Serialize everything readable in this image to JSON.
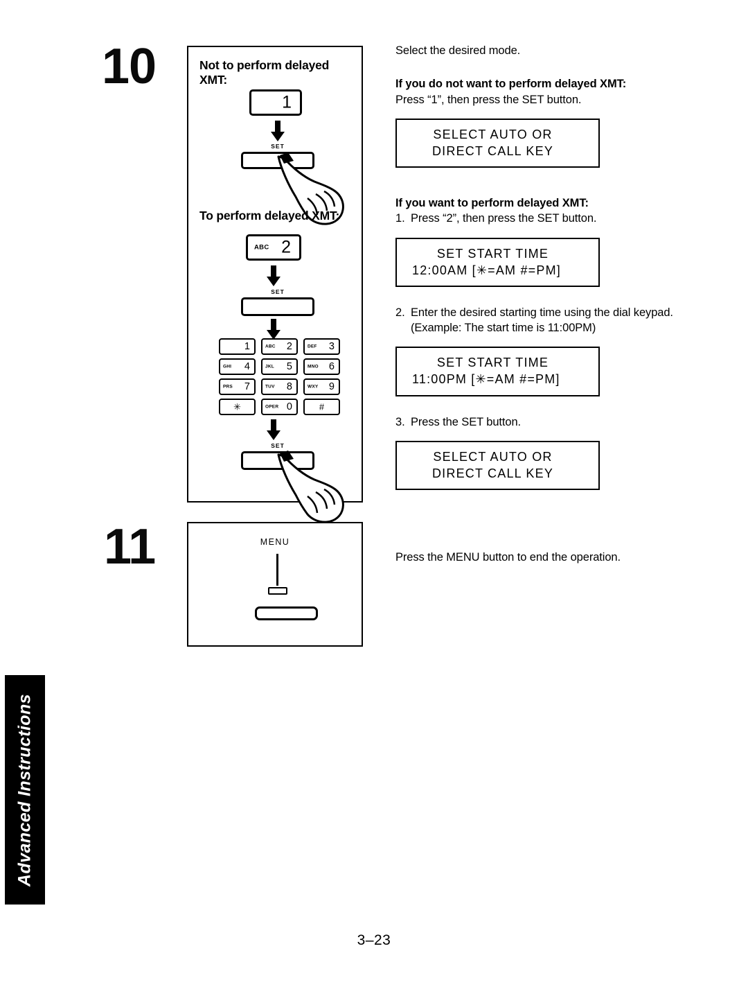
{
  "page": {
    "number": "3–23",
    "side_tab": "Advanced Instructions"
  },
  "steps": [
    {
      "number": "10",
      "illustration": {
        "heading_not_delayed": "Not to perform delayed XMT:",
        "heading_to_delayed": "To perform delayed XMT:",
        "key_one_digit": "1",
        "key_two_letters": "ABC",
        "key_two_digit": "2",
        "set_button_label": "SET",
        "keypad": [
          [
            {
              "letters": "",
              "digit": "1"
            },
            {
              "letters": "ABC",
              "digit": "2"
            },
            {
              "letters": "DEF",
              "digit": "3"
            }
          ],
          [
            {
              "letters": "GHI",
              "digit": "4"
            },
            {
              "letters": "JKL",
              "digit": "5"
            },
            {
              "letters": "MNO",
              "digit": "6"
            }
          ],
          [
            {
              "letters": "PRS",
              "digit": "7"
            },
            {
              "letters": "TUV",
              "digit": "8"
            },
            {
              "letters": "WXY",
              "digit": "9"
            }
          ],
          [
            {
              "letters": "",
              "digit": "",
              "center": "✳"
            },
            {
              "letters": "OPER",
              "digit": "0"
            },
            {
              "letters": "",
              "digit": "",
              "center": "#"
            }
          ]
        ]
      },
      "instructions": {
        "intro": "Select the desired mode.",
        "not_delayed_heading": "If you do not want to perform delayed XMT:",
        "not_delayed_text": "Press “1”, then press the SET button.",
        "lcd_1": {
          "line1": "SELECT AUTO OR",
          "line2": "DIRECT CALL KEY"
        },
        "delayed_heading": "If you want to perform delayed XMT:",
        "item_1_num": "1.",
        "item_1_text": "Press “2”, then press the SET button.",
        "lcd_2": {
          "line1": "SET START TIME",
          "line2": "12:00AM [✳=AM #=PM]"
        },
        "item_2_num": "2.",
        "item_2_text": "Enter the desired starting time using the dial keypad. (Example:  The start time is 11:00PM)",
        "lcd_3": {
          "line1": "SET START TIME",
          "line2": "11:00PM [✳=AM #=PM]"
        },
        "item_3_num": "3.",
        "item_3_text": "Press the SET button.",
        "lcd_4": {
          "line1": "SELECT AUTO OR",
          "line2": "DIRECT CALL KEY"
        }
      }
    },
    {
      "number": "11",
      "illustration": {
        "menu_label": "MENU"
      },
      "instructions": {
        "text": "Press the MENU button to end the operation."
      }
    }
  ]
}
